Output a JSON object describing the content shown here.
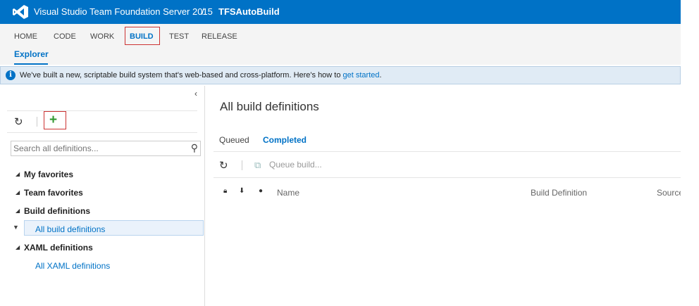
{
  "header": {
    "product": "Visual Studio Team Foundation Server 2015",
    "separator": "/",
    "project": "TFSAutoBuild",
    "accent_color": "#0072c6"
  },
  "hubs": [
    {
      "label": "HOME",
      "active": false
    },
    {
      "label": "CODE",
      "active": false
    },
    {
      "label": "WORK",
      "active": false
    },
    {
      "label": "BUILD",
      "active": true
    },
    {
      "label": "TEST",
      "active": false
    },
    {
      "label": "RELEASE",
      "active": false
    }
  ],
  "subnav": {
    "label": "Explorer"
  },
  "infobar": {
    "icon": "info-icon",
    "text": "We've built a new, scriptable build system that's web-based and cross-platform. Here's how to ",
    "link": "get started",
    "suffix": "."
  },
  "left_pane": {
    "collapse_icon": "chevron-left-icon",
    "refresh_icon": "refresh-icon",
    "add_icon": "plus-icon",
    "search": {
      "placeholder": "Search all definitions...",
      "value": ""
    },
    "tree": [
      {
        "label": "My favorites",
        "expanded": false,
        "children": []
      },
      {
        "label": "Team favorites",
        "expanded": false,
        "children": []
      },
      {
        "label": "Build definitions",
        "expanded": true,
        "children": [
          "All build definitions"
        ]
      },
      {
        "label": "XAML definitions",
        "expanded": true,
        "children": [
          "All XAML definitions"
        ]
      }
    ],
    "selected": "All build definitions"
  },
  "main": {
    "title": "All build definitions",
    "tabs": [
      {
        "label": "Queued",
        "active": false
      },
      {
        "label": "Completed",
        "active": true
      }
    ],
    "toolbar": {
      "queue_label": "Queue build..."
    },
    "columns": [
      "Name",
      "Build Definition",
      "Source"
    ]
  }
}
